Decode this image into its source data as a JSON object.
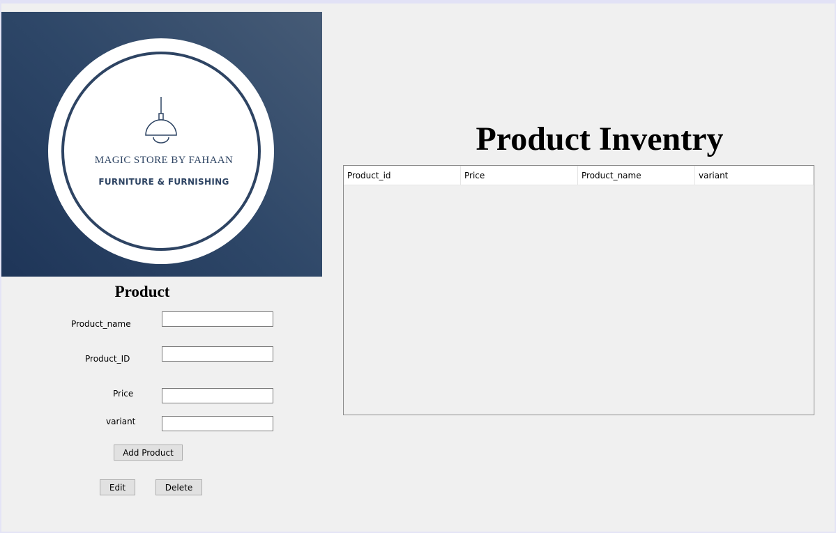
{
  "logo": {
    "title": "MAGIC STORE BY FAHAAN",
    "subtitle": "FURNITURE & FURNISHING",
    "icon": "pendant-lamp-icon"
  },
  "form": {
    "title": "Product",
    "fields": {
      "product_name": {
        "label": "Product_name",
        "value": ""
      },
      "product_id": {
        "label": "Product_ID",
        "value": ""
      },
      "price": {
        "label": "Price",
        "value": ""
      },
      "variant": {
        "label": "variant",
        "value": ""
      }
    },
    "buttons": {
      "add": "Add Product",
      "edit": "Edit",
      "delete": "Delete"
    }
  },
  "inventory": {
    "title": "Product Inventry",
    "columns": [
      "Product_id",
      "Price",
      "Product_name",
      "variant"
    ],
    "rows": []
  },
  "colors": {
    "logo_navy": "#2e4463",
    "logo_bg_dark": "#1e3558",
    "window_bg": "#f0f0f0"
  }
}
